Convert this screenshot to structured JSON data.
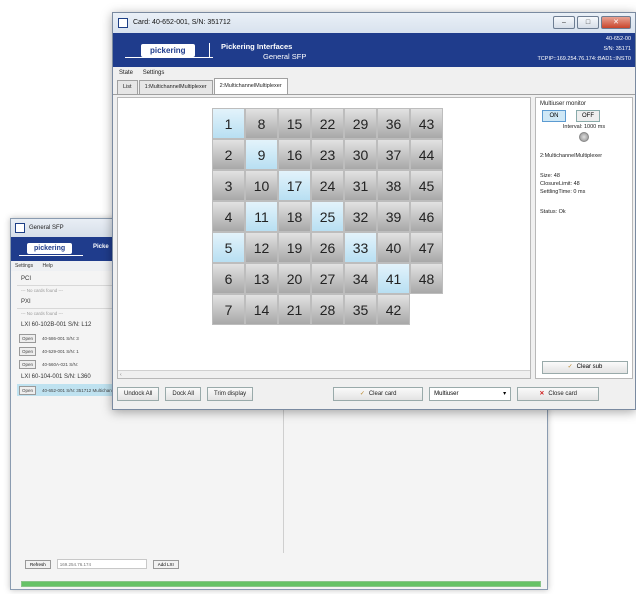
{
  "back_window": {
    "title": "General SFP",
    "brand": "Picke",
    "logo": "pickering",
    "menu": [
      "Settings",
      "Help"
    ],
    "pci_label": "PCI",
    "pci_none": "--- No cards found ---",
    "pxi_label": "PXI",
    "pxi_none": "--- No cards found ---",
    "lxi1_label": "LXI 60-102B-001 S/N: L12",
    "lxi1_devices": [
      {
        "open": "Open",
        "text": "40-586-001 S/N: 3"
      },
      {
        "open": "Open",
        "text": "40-529-001 S/N: 1"
      },
      {
        "open": "Open",
        "text": "40-560A-021 S/N:"
      }
    ],
    "lxi2_label": "LXI 60-104-001 S/N: L360",
    "lxi2_devices": [
      {
        "open": "Open",
        "text": "40-652-001 S/N: 351712  MultichannelMultiplexer"
      }
    ],
    "refresh_label": "Refresh",
    "ip_placeholder": "169.254.76.174",
    "add_lxi_label": "Add LXI",
    "progress": 1.0
  },
  "front_window": {
    "title": "Card: 40-652-001, S/N: 351712",
    "logo": "pickering",
    "brand_line1": "Pickering Interfaces",
    "brand_line2": "General SFP",
    "banner_right": [
      "40-652-00",
      "S/N: 35171",
      "TCPIP::169.254.76.174::BAD1::INST0"
    ],
    "menu": [
      "State",
      "Settings"
    ],
    "tabs": [
      "List",
      "1:MultichannelMultiplexer",
      "2:MultichannelMultiplexer"
    ],
    "active_tab": 2,
    "grid": {
      "columns": 7,
      "cells": [
        {
          "n": "1",
          "on": true
        },
        {
          "n": "8",
          "on": false
        },
        {
          "n": "15",
          "on": false
        },
        {
          "n": "22",
          "on": false
        },
        {
          "n": "29",
          "on": false
        },
        {
          "n": "36",
          "on": false
        },
        {
          "n": "43",
          "on": false
        },
        {
          "n": "2",
          "on": false
        },
        {
          "n": "9",
          "on": true
        },
        {
          "n": "16",
          "on": false
        },
        {
          "n": "23",
          "on": false
        },
        {
          "n": "30",
          "on": false
        },
        {
          "n": "37",
          "on": false
        },
        {
          "n": "44",
          "on": false
        },
        {
          "n": "3",
          "on": false
        },
        {
          "n": "10",
          "on": false
        },
        {
          "n": "17",
          "on": true
        },
        {
          "n": "24",
          "on": false
        },
        {
          "n": "31",
          "on": false
        },
        {
          "n": "38",
          "on": false
        },
        {
          "n": "45",
          "on": false
        },
        {
          "n": "4",
          "on": false
        },
        {
          "n": "11",
          "on": true
        },
        {
          "n": "18",
          "on": false
        },
        {
          "n": "25",
          "on": true
        },
        {
          "n": "32",
          "on": false
        },
        {
          "n": "39",
          "on": false
        },
        {
          "n": "46",
          "on": false
        },
        {
          "n": "5",
          "on": true
        },
        {
          "n": "12",
          "on": false
        },
        {
          "n": "19",
          "on": false
        },
        {
          "n": "26",
          "on": false
        },
        {
          "n": "33",
          "on": true
        },
        {
          "n": "40",
          "on": false
        },
        {
          "n": "47",
          "on": false
        },
        {
          "n": "6",
          "on": false
        },
        {
          "n": "13",
          "on": false
        },
        {
          "n": "20",
          "on": false
        },
        {
          "n": "27",
          "on": false
        },
        {
          "n": "34",
          "on": false
        },
        {
          "n": "41",
          "on": true
        },
        {
          "n": "48",
          "on": false
        },
        {
          "n": "7",
          "on": false
        },
        {
          "n": "14",
          "on": false
        },
        {
          "n": "21",
          "on": false
        },
        {
          "n": "28",
          "on": false
        },
        {
          "n": "35",
          "on": false
        },
        {
          "n": "42",
          "on": false
        },
        {
          "n": "",
          "on": false
        }
      ]
    },
    "monitor": {
      "title": "Multiuser monitor",
      "on_label": "ON",
      "off_label": "OFF",
      "interval": "Interval: 1000 ms",
      "card_name": "2:MultichannelMultiplexer",
      "size": "Size: 48",
      "closure_limit": "ClosureLimit: 48",
      "settling_time": "SettlingTime: 0 ms",
      "status": "Status: Ok",
      "clear_sub_label": "Clear sub"
    },
    "bottom": {
      "undock_all": "Undock All",
      "dock_all": "Dock All",
      "trim_display": "Trim display",
      "clear_card": "Clear card",
      "mode_value": "Multiuser",
      "close_card": "Close card"
    },
    "colors": {
      "banner": "#1f3c8c",
      "cell_on": "#b8dff2",
      "cell_off": "#a8a8a8"
    }
  }
}
